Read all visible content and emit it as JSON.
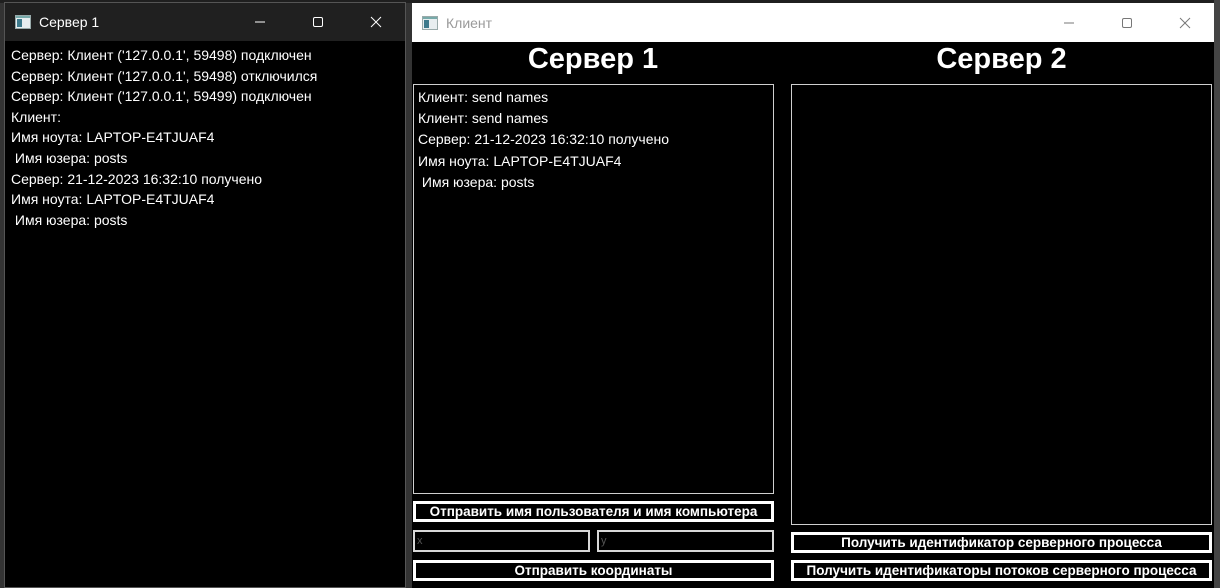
{
  "server_window": {
    "title": "Сервер 1",
    "log": [
      "Сервер: Клиент ('127.0.0.1', 59498) подключен",
      "Сервер: Клиент ('127.0.0.1', 59498) отключился",
      "Сервер: Клиент ('127.0.0.1', 59499) подключен",
      "Клиент:",
      "Имя ноута: LAPTOP-E4TJUAF4",
      " Имя юзера: posts",
      "Сервер: 21-12-2023 16:32:10 получено",
      "Имя ноута: LAPTOP-E4TJUAF4",
      " Имя юзера: posts"
    ]
  },
  "client_window": {
    "title": "Клиент",
    "server1": {
      "heading": "Сервер 1",
      "log": [
        "Клиент: send names",
        "Клиент: send names",
        "Сервер: 21-12-2023 16:32:10 получено",
        "Имя ноута: LAPTOP-E4TJUAF4",
        " Имя юзера: posts"
      ],
      "send_names_label": "Отправить имя пользователя и имя компьютера",
      "x_placeholder": "x",
      "y_placeholder": "y",
      "x_value": "",
      "y_value": "",
      "send_coords_label": "Отправить координаты"
    },
    "server2": {
      "heading": "Сервер 2",
      "log": [],
      "get_process_id_label": "Получить идентификатор серверного процесса",
      "get_thread_ids_label": "Получить идентификаторы потоков серверного процесса"
    }
  },
  "icons": {
    "app": "app-window-icon",
    "minimize": "minimize-icon",
    "maximize": "maximize-icon",
    "close": "close-icon"
  },
  "colors": {
    "console_bg": "#000000",
    "console_text": "#ffffff",
    "dark_titlebar": "#202020",
    "light_titlebar": "#ffffff",
    "button_border": "#ffffff"
  }
}
